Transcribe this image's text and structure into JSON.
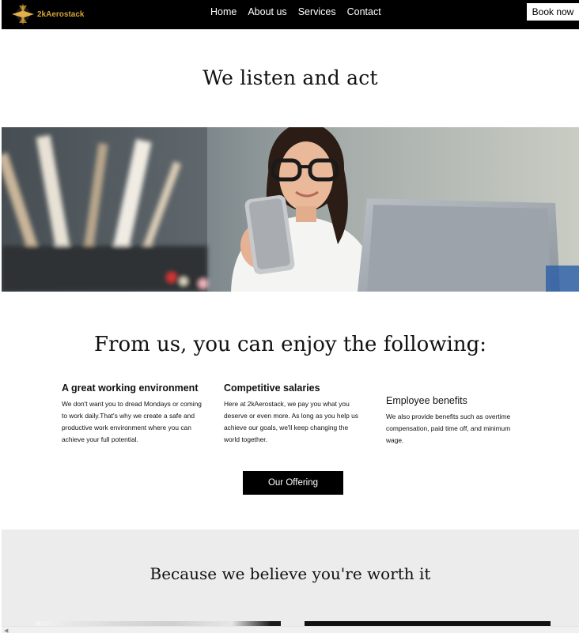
{
  "brand": {
    "name": "2kAerostack",
    "accent": "#d4a23a"
  },
  "nav": {
    "links": [
      "Home",
      "About us",
      "Services",
      "Contact"
    ],
    "cta": "Book now"
  },
  "hero": {
    "title": "We listen and act"
  },
  "photo": {
    "icon": "woman-with-phone-photo"
  },
  "benefits": {
    "title": "From us, you can enjoy the following:",
    "items": [
      {
        "heading": "A great working environment",
        "body": "We don't want you to dread Mondays or coming to work daily.That's why we create a safe and productive work environment where you can achieve your full potential."
      },
      {
        "heading": "Competitive salaries",
        "body": "Here at 2kAerostack, we pay you what you deserve or even more. As long as you help us achieve our goals, we'll keep changing the world together."
      },
      {
        "heading": "Employee benefits",
        "body": "We also provide benefits such as overtime compensation, paid time off, and minimum wage."
      }
    ],
    "cta": "Our Offering"
  },
  "worth": {
    "title": "Because we believe you're worth it"
  }
}
